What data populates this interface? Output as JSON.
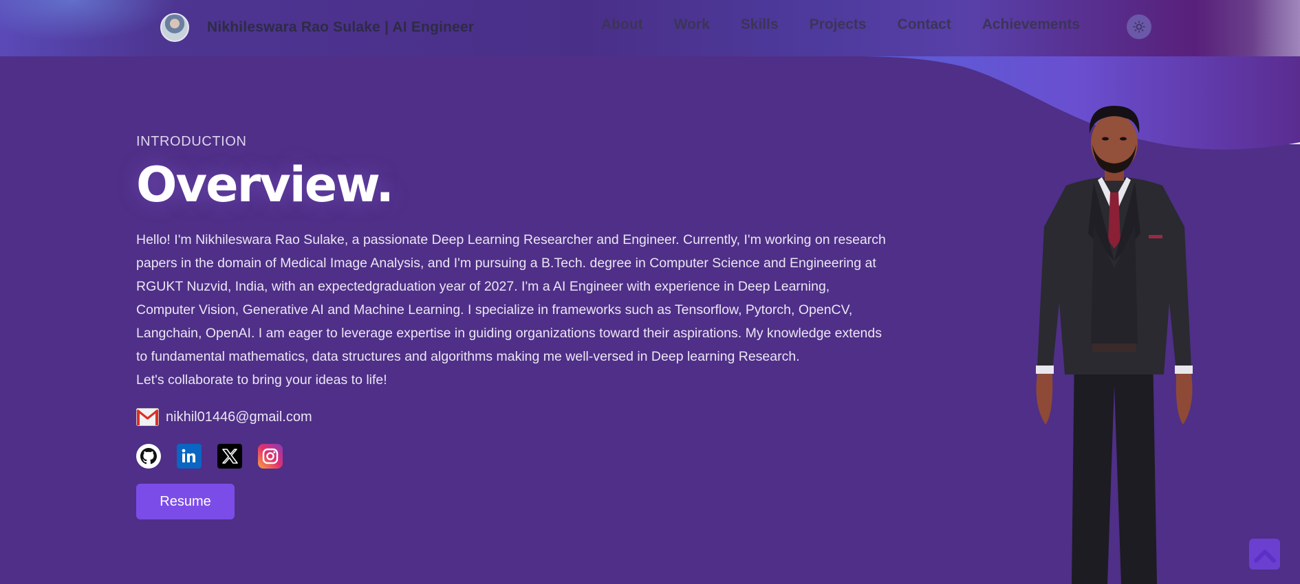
{
  "header": {
    "brand_name": "Nikhileswara Rao Sulake  | AI Engineer",
    "nav": {
      "about": "About",
      "work": "Work",
      "skills": "Skills",
      "projects": "Projects",
      "contact": "Contact",
      "achievements": "Achievements"
    },
    "theme_icon": "sun-icon"
  },
  "intro": {
    "kicker": "INTRODUCTION",
    "title": "Overview.",
    "bio": "Hello! I'm Nikhileswara Rao Sulake, a passionate Deep Learning Researcher and Engineer. Currently, I'm working on research papers in the domain of Medical Image Analysis, and I'm pursuing a B.Tech. degree in Computer Science and Engineering at RGUKT Nuzvid, India, with an expectedgraduation year of 2027. I'm a AI Engineer with experience in Deep Learning, Computer Vision, Generative AI and Machine Learning. I specialize in frameworks such as Tensorflow, Pytorch, OpenCV, Langchain, OpenAI. I am eager to leverage expertise in guiding organizations toward their aspirations. My knowledge extends to fundamental mathematics, data structures and algorithms making me well-versed in Deep learning Research.",
    "cta": "Let's collaborate to bring your ideas to life!",
    "email": "nikhil01446@gmail.com",
    "socials": [
      "github-icon",
      "linkedin-icon",
      "x-icon",
      "instagram-icon"
    ],
    "resume_label": "Resume"
  },
  "colors": {
    "background": "#4f2f87",
    "accent": "#7c4ce8"
  }
}
